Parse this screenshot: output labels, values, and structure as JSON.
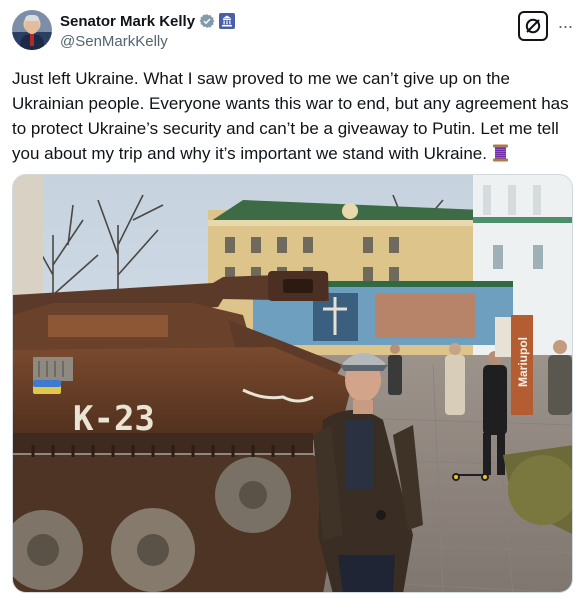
{
  "author": {
    "display_name": "Senator Mark Kelly",
    "handle": "@SenMarkKelly",
    "verified_icon": "verified-badge-icon",
    "affiliation_icon": "government-badge-icon"
  },
  "actions": {
    "grok_icon": "grok-icon",
    "more_label": "···"
  },
  "tweet": {
    "text": "Just left Ukraine. What I saw proved to me we can’t give up on the Ukrainian people. Everyone wants this war to end, but any agreement has to protect Ukraine’s security and can’t be a giveaway to Putin. Let me tell you about my trip and why it’s important we stand with Ukraine.",
    "emoji": "thread-spool-icon"
  },
  "photo": {
    "tank_graffiti": "K-23",
    "sign_text": "Mariupol"
  },
  "colors": {
    "accent_blue": "#1d9bf0",
    "text_primary": "#0f1419",
    "text_secondary": "#536471"
  }
}
